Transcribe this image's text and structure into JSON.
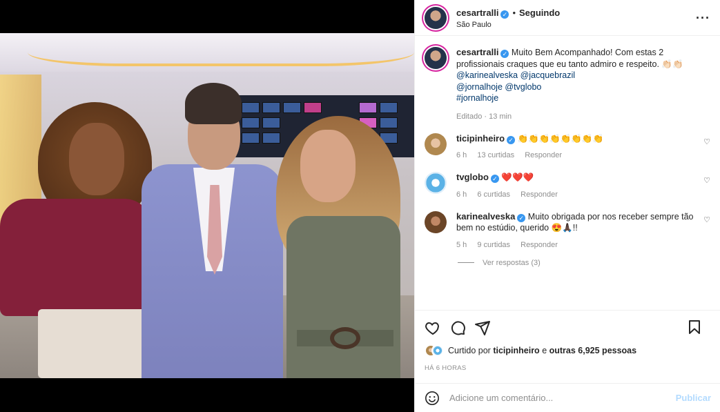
{
  "post": {
    "author": "cesartralli",
    "follow_status": "Seguindo",
    "location": "São Paulo",
    "more_icon": "more-options-icon"
  },
  "caption": {
    "username": "cesartralli",
    "text": "Muito Bem Acompanhado! Com estas 2 profissionais craques que eu tanto admiro e respeito. 👏🏻👏🏻",
    "mention1": "@karinealveska",
    "mention2": "@jacquebrazil",
    "mention3": "@jornalhoje",
    "mention4": "@tvglobo",
    "hashtag": "#jornalhoje",
    "edited": "Editado",
    "time": "13 min"
  },
  "comments": [
    {
      "username": "ticipinheiro",
      "text": "👏👏👏👏👏👏👏👏",
      "time": "6 h",
      "likes": "13 curtidas",
      "reply": "Responder"
    },
    {
      "username": "tvglobo",
      "text": "❤️❤️❤️",
      "time": "6 h",
      "likes": "6 curtidas",
      "reply": "Responder"
    },
    {
      "username": "karinealveska",
      "text": "Muito obrigada por nos receber sempre tão bem no estúdio, querido 😍🙏🏿!!",
      "time": "5 h",
      "likes": "9 curtidas",
      "reply": "Responder",
      "view_replies": "Ver respostas (3)"
    }
  ],
  "likes_line": {
    "prefix": "Curtido por",
    "user": "ticipinheiro",
    "middle": "e",
    "rest": "outras 6,925 pessoas"
  },
  "posted_ago": "HÁ 6 HORAS",
  "add_comment": {
    "placeholder": "Adicione um comentário...",
    "publish": "Publicar"
  },
  "colors": {
    "verified": "#3897f0",
    "link": "#00376b",
    "publish_disabled": "#b3dbff"
  }
}
